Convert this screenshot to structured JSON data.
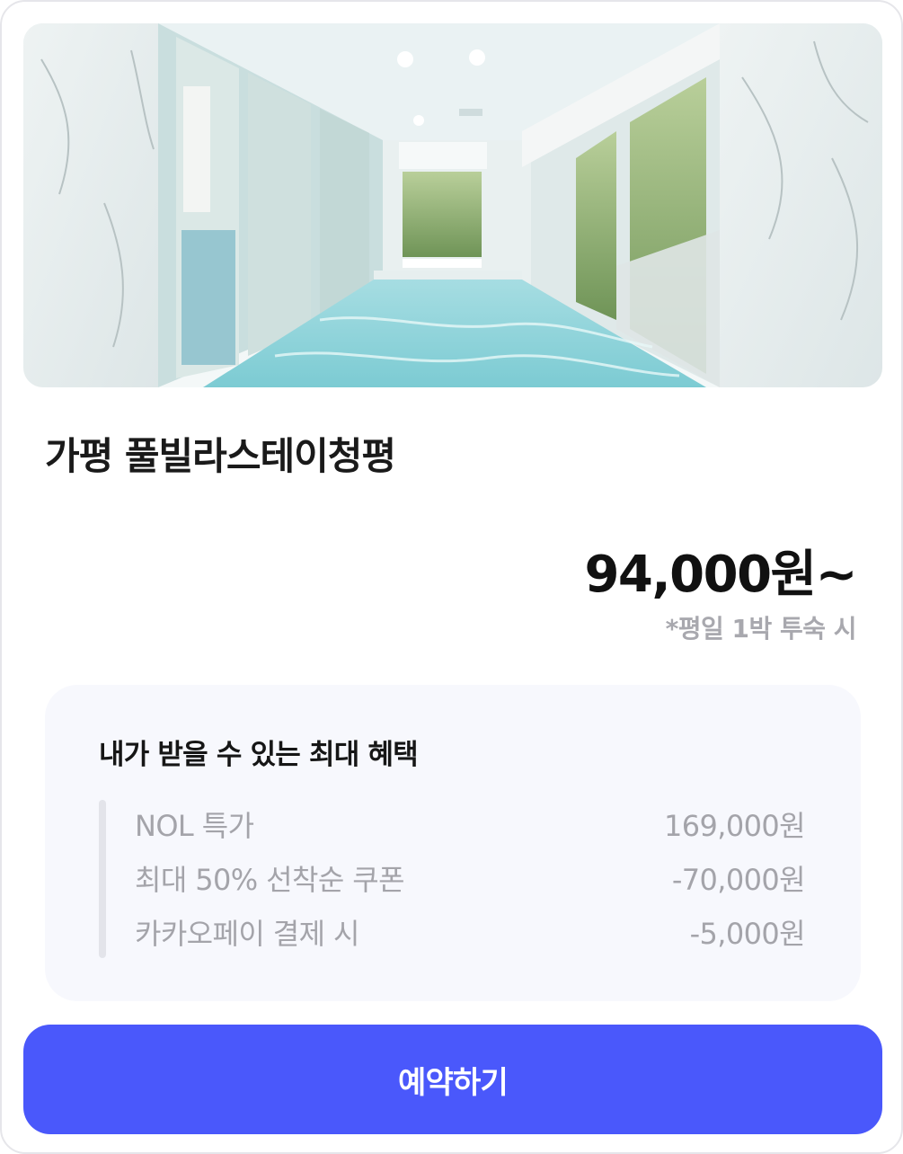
{
  "listing": {
    "name": "가평 풀빌라스테이청평",
    "photo_alt": "indoor swimming pool with glass walls and marble panels"
  },
  "pricing": {
    "price": "94,000원~",
    "note": "*평일 1박 투숙 시"
  },
  "benefits": {
    "title": "내가 받을 수 있는 최대 혜택",
    "rows": [
      {
        "label": "NOL 특가",
        "value": "169,000원"
      },
      {
        "label": "최대 50% 선착순 쿠폰",
        "value": "-70,000원"
      },
      {
        "label": "카카오페이 결제 시",
        "value": "-5,000원"
      }
    ]
  },
  "actions": {
    "reserve_label": "예약하기"
  },
  "colors": {
    "accent": "#4a58fb",
    "panel": "#f7f8fd",
    "muted_text": "#a4a4aa"
  }
}
